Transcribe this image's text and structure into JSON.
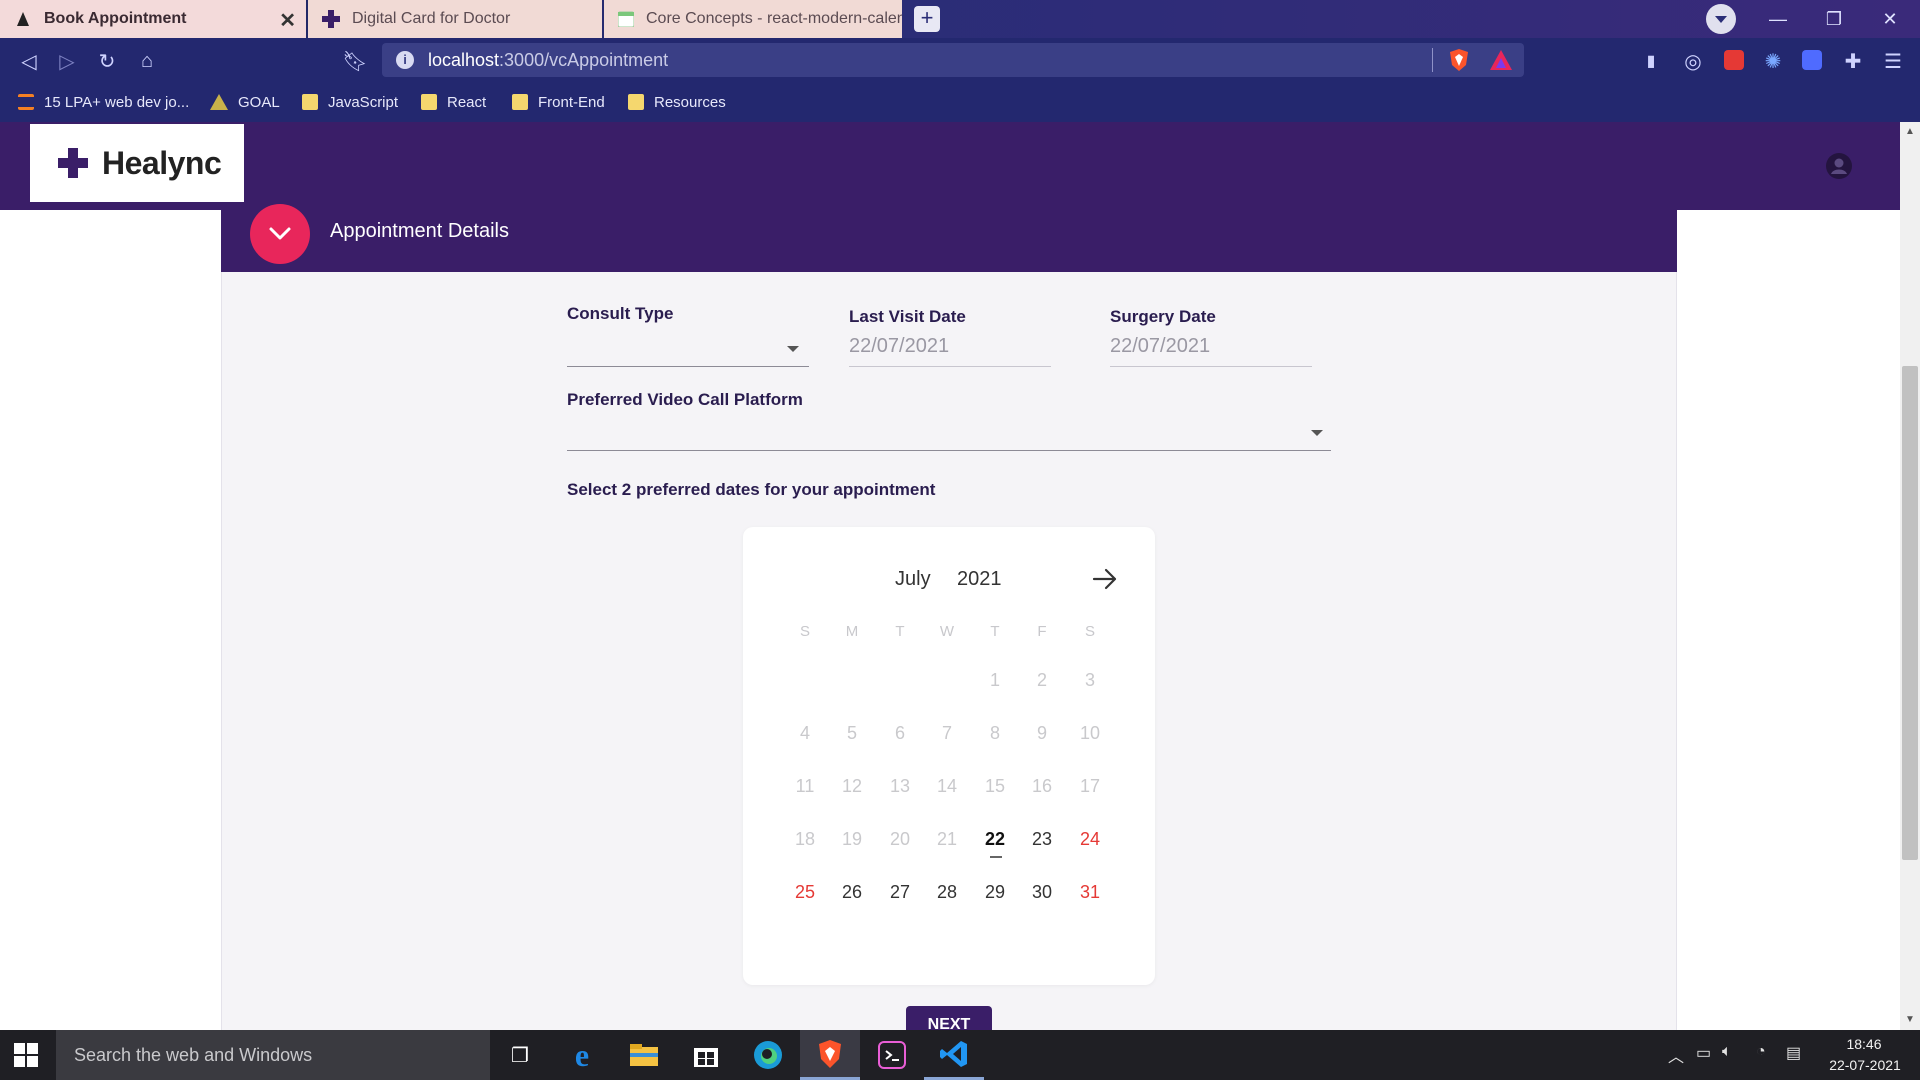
{
  "browser": {
    "tabs": [
      {
        "title": "Book Appointment",
        "active": true
      },
      {
        "title": "Digital Card for Doctor",
        "active": false
      },
      {
        "title": "Core Concepts - react-modern-calend",
        "active": false
      }
    ],
    "url_host": "localhost",
    "url_path": ":3000/vcAppointment",
    "bookmarks": [
      "15 LPA+ web dev jo...",
      "GOAL",
      "JavaScript",
      "React",
      "Front-End",
      "Resources"
    ]
  },
  "app": {
    "brand": "Healync",
    "section_title": "Appointment Details",
    "form": {
      "consult_type_label": "Consult Type",
      "consult_type_value": "",
      "last_visit_label": "Last Visit Date",
      "last_visit_value": "22/07/2021",
      "surgery_label": "Surgery Date",
      "surgery_value": "22/07/2021",
      "platform_label": "Preferred Video Call Platform",
      "platform_value": "",
      "dates_prompt": "Select 2 preferred dates for your appointment"
    },
    "calendar": {
      "month": "July",
      "year": "2021",
      "weekdays": [
        "S",
        "M",
        "T",
        "W",
        "T",
        "F",
        "S"
      ],
      "weeks": [
        [
          "",
          "",
          "",
          "",
          "1",
          "2",
          "3"
        ],
        [
          "4",
          "5",
          "6",
          "7",
          "8",
          "9",
          "10"
        ],
        [
          "11",
          "12",
          "13",
          "14",
          "15",
          "16",
          "17"
        ],
        [
          "18",
          "19",
          "20",
          "21",
          "22",
          "23",
          "24"
        ],
        [
          "25",
          "26",
          "27",
          "28",
          "29",
          "30",
          "31"
        ]
      ],
      "today": "22",
      "first_enabled": 22
    },
    "next_button": "NEXT"
  },
  "taskbar": {
    "search_placeholder": "Search the web and Windows",
    "time": "18:46",
    "date": "22-07-2021"
  },
  "colors": {
    "header": "#3a1e68",
    "accent": "#e8265b",
    "weekend": "#e53935"
  }
}
